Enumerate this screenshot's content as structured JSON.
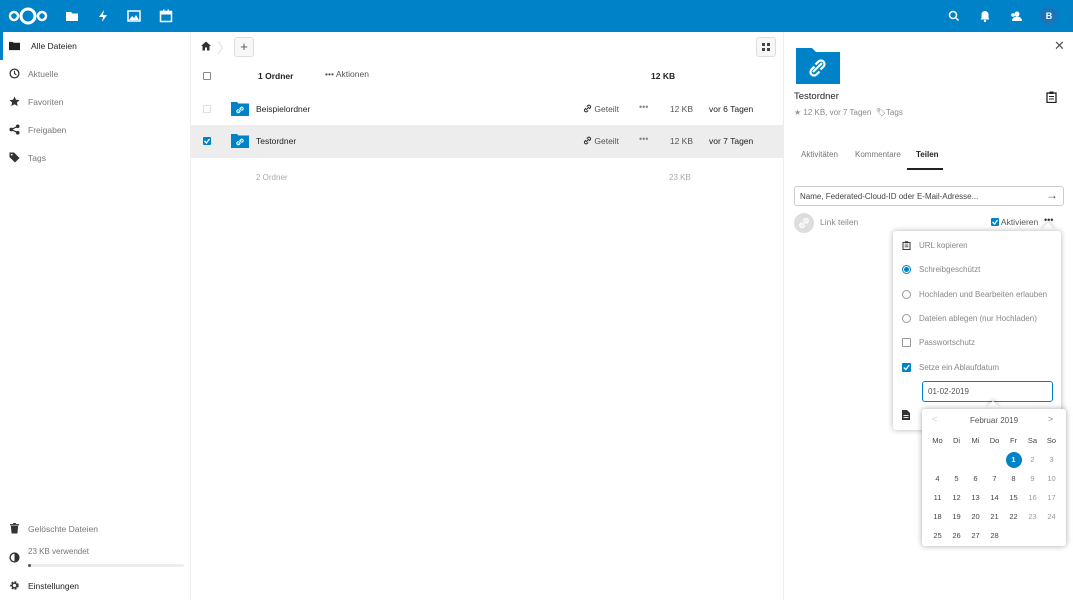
{
  "header": {
    "apps": [
      "files-icon",
      "activity-icon",
      "gallery-icon",
      "calendar-icon"
    ],
    "right_icons": [
      "search-icon",
      "notifications-icon",
      "contacts-icon"
    ],
    "avatar_initial": "B",
    "brand_color": "#0082c9"
  },
  "nav": {
    "items": [
      {
        "label": "Alle Dateien",
        "icon": "folder-icon",
        "active": true
      },
      {
        "label": "Aktuelle",
        "icon": "clock-icon"
      },
      {
        "label": "Favoriten",
        "icon": "star-icon"
      },
      {
        "label": "Freigaben",
        "icon": "share-icon"
      },
      {
        "label": "Tags",
        "icon": "tag-icon"
      }
    ],
    "trash": "Gelöschte Dateien",
    "quota": "23 KB verwendet",
    "settings": "Einstellungen"
  },
  "files": {
    "header": {
      "count": "1 Ordner",
      "actions": "Aktionen",
      "size": "12 KB"
    },
    "rows": [
      {
        "name": "Beispielordner",
        "shared": "Geteilt",
        "size": "12 KB",
        "modified": "vor 6 Tagen",
        "selected": false
      },
      {
        "name": "Testordner",
        "shared": "Geteilt",
        "size": "12 KB",
        "modified": "vor 7 Tagen",
        "selected": true
      }
    ],
    "summary": {
      "count": "2 Ordner",
      "size": "23 KB"
    }
  },
  "sidebar": {
    "title": "Testordner",
    "meta_size": "12 KB, vor 7 Tagen",
    "meta_tags": "Tags",
    "tabs": [
      "Aktivitäten",
      "Kommentare",
      "Teilen"
    ],
    "active_tab": "Teilen",
    "share_placeholder": "Name, Federated-Cloud-ID oder E-Mail-Adresse...",
    "link_label": "Link teilen",
    "activate_label": "Aktivieren"
  },
  "popover": {
    "items": [
      {
        "label": "URL kopieren",
        "icon": "clipboard-icon"
      },
      {
        "label": "Schreibgeschützt",
        "type": "radio",
        "checked": true
      },
      {
        "label": "Hochladen und Bearbeiten erlauben",
        "type": "radio",
        "checked": false
      },
      {
        "label": "Dateien ablegen (nur Hochladen)",
        "type": "radio",
        "checked": false
      },
      {
        "label": "Passwortschutz",
        "type": "checkbox",
        "checked": false
      },
      {
        "label": "Setze ein Ablaufdatum",
        "type": "checkbox",
        "checked": true
      }
    ],
    "date_value": "01-02-2019"
  },
  "datepicker": {
    "month": "Februar 2019",
    "weekdays": [
      "Mo",
      "Di",
      "Mi",
      "Do",
      "Fr",
      "Sa",
      "So"
    ],
    "weeks": [
      [
        "",
        "",
        "",
        "",
        "1",
        "2",
        "3"
      ],
      [
        "4",
        "5",
        "6",
        "7",
        "8",
        "9",
        "10"
      ],
      [
        "11",
        "12",
        "13",
        "14",
        "15",
        "16",
        "17"
      ],
      [
        "18",
        "19",
        "20",
        "21",
        "22",
        "23",
        "24"
      ],
      [
        "25",
        "26",
        "27",
        "28",
        "",
        "",
        ""
      ]
    ],
    "selected_day": "1"
  }
}
